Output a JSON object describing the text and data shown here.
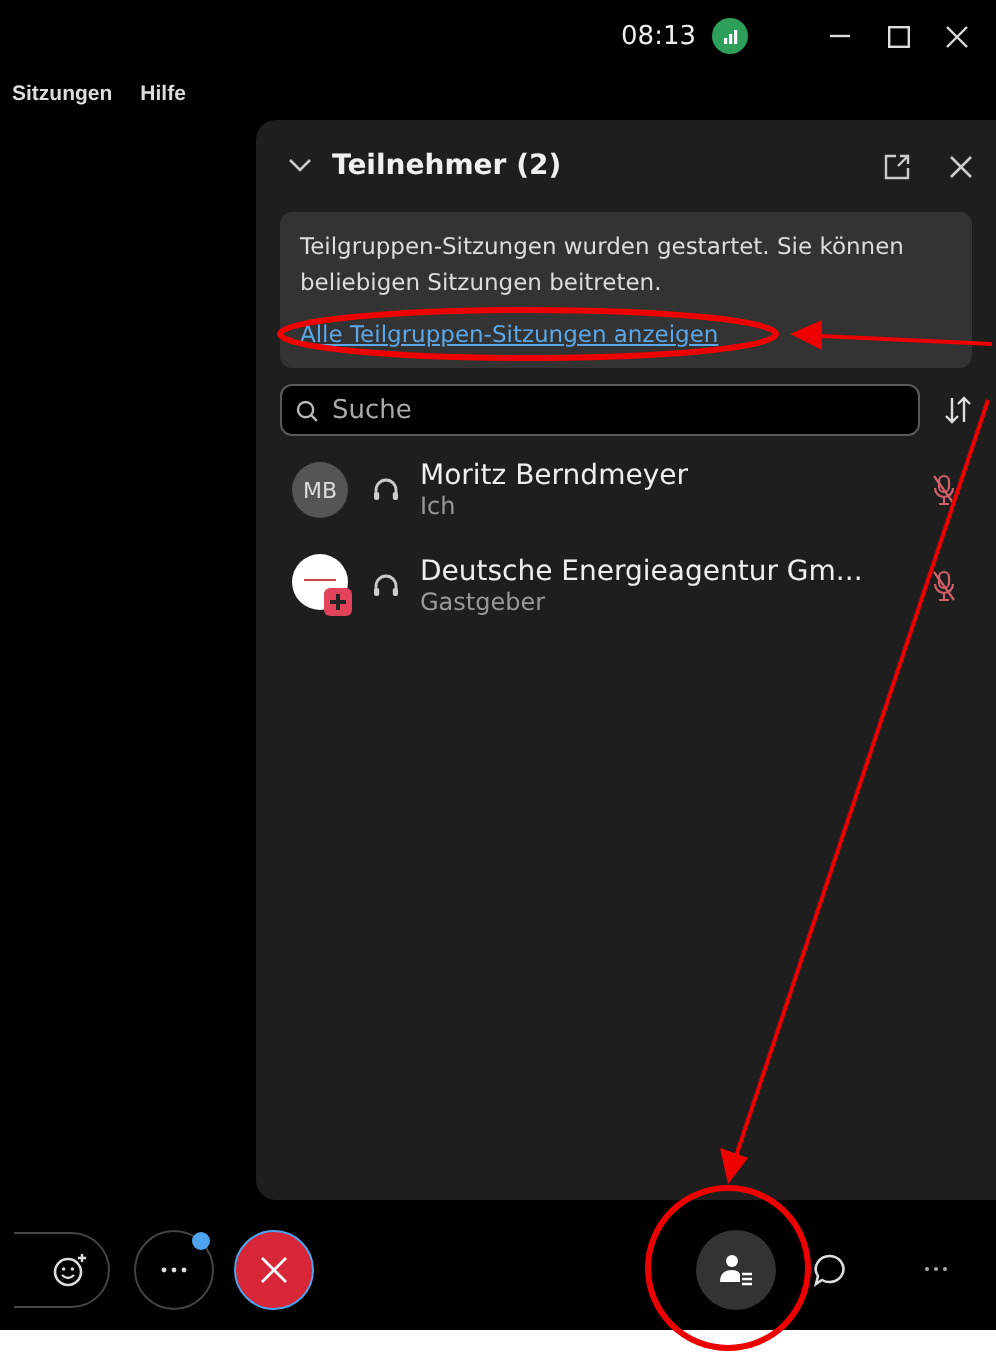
{
  "title_bar": {
    "time": "08:13"
  },
  "menu": [
    "Sitzungen",
    "Hilfe"
  ],
  "panel": {
    "title": "Teilnehmer (2)",
    "expanded": true,
    "notice": {
      "text": "Teilgruppen-Sitzungen wurden gestartet. Sie können beliebigen Sitzungen beitreten.",
      "link": "Alle Teilgruppen-Sitzungen anzeigen"
    },
    "search": {
      "placeholder": "Suche"
    },
    "participants": [
      {
        "avatar": {
          "kind": "initials",
          "initials": "MB"
        },
        "name": "Moritz Berndmeyer",
        "role": "Ich",
        "muted": true
      },
      {
        "avatar": {
          "kind": "logo"
        },
        "name": "Deutsche Energieagentur Gm...",
        "role": "Gastgeber",
        "muted": true
      }
    ]
  },
  "toolbar": {
    "more_badge": true,
    "participants_selected": true
  }
}
